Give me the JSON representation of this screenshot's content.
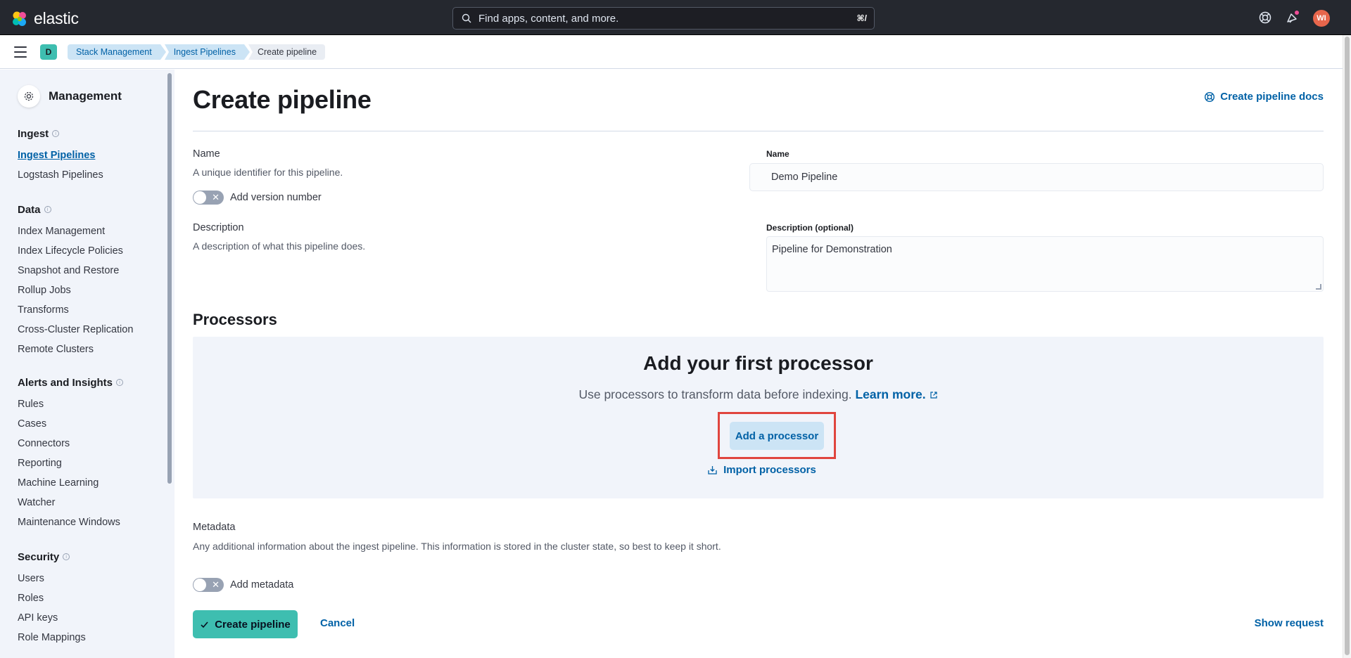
{
  "header": {
    "logo_text": "elastic",
    "search_placeholder": "Find apps, content, and more.",
    "search_shortcut": "⌘/",
    "user_initials": "WI",
    "icons": [
      "elastic-logo-icon",
      "search-icon",
      "help-icon",
      "newsfeed-icon"
    ]
  },
  "breadcrumbs": {
    "space_initial": "D",
    "items": [
      "Stack Management",
      "Ingest Pipelines",
      "Create pipeline"
    ]
  },
  "sidebar": {
    "title": "Management",
    "groups": [
      {
        "label": "Ingest",
        "items": [
          "Ingest Pipelines",
          "Logstash Pipelines"
        ]
      },
      {
        "label": "Data",
        "items": [
          "Index Management",
          "Index Lifecycle Policies",
          "Snapshot and Restore",
          "Rollup Jobs",
          "Transforms",
          "Cross-Cluster Replication",
          "Remote Clusters"
        ]
      },
      {
        "label": "Alerts and Insights",
        "items": [
          "Rules",
          "Cases",
          "Connectors",
          "Reporting",
          "Machine Learning",
          "Watcher",
          "Maintenance Windows"
        ]
      },
      {
        "label": "Security",
        "items": [
          "Users",
          "Roles",
          "API keys",
          "Role Mappings"
        ]
      }
    ],
    "active_item": "Ingest Pipelines"
  },
  "main": {
    "title": "Create pipeline",
    "docs_link": "Create pipeline docs",
    "name_section": {
      "title": "Name",
      "help": "A unique identifier for this pipeline.",
      "toggle_label": "Add version number",
      "input_label": "Name",
      "input_value": "Demo Pipeline"
    },
    "description_section": {
      "title": "Description",
      "help": "A description of what this pipeline does.",
      "input_label": "Description (optional)",
      "input_value": "Pipeline for Demonstration"
    },
    "processors": {
      "title": "Processors",
      "empty_title": "Add your first processor",
      "empty_body": "Use processors to transform data before indexing.",
      "learn_more": "Learn more.",
      "add_button": "Add a processor",
      "import_link": "Import processors"
    },
    "metadata": {
      "title": "Metadata",
      "help": "Any additional information about the ingest pipeline. This information is stored in the cluster state, so best to keep it short.",
      "toggle_label": "Add metadata"
    },
    "footer": {
      "create_button": "Create pipeline",
      "cancel_button": "Cancel",
      "show_request": "Show request"
    }
  },
  "colors": {
    "header_bg": "#25282f",
    "primary_link": "#0061a6",
    "success_button": "#3ebeb0",
    "highlight": "#e0453e"
  }
}
